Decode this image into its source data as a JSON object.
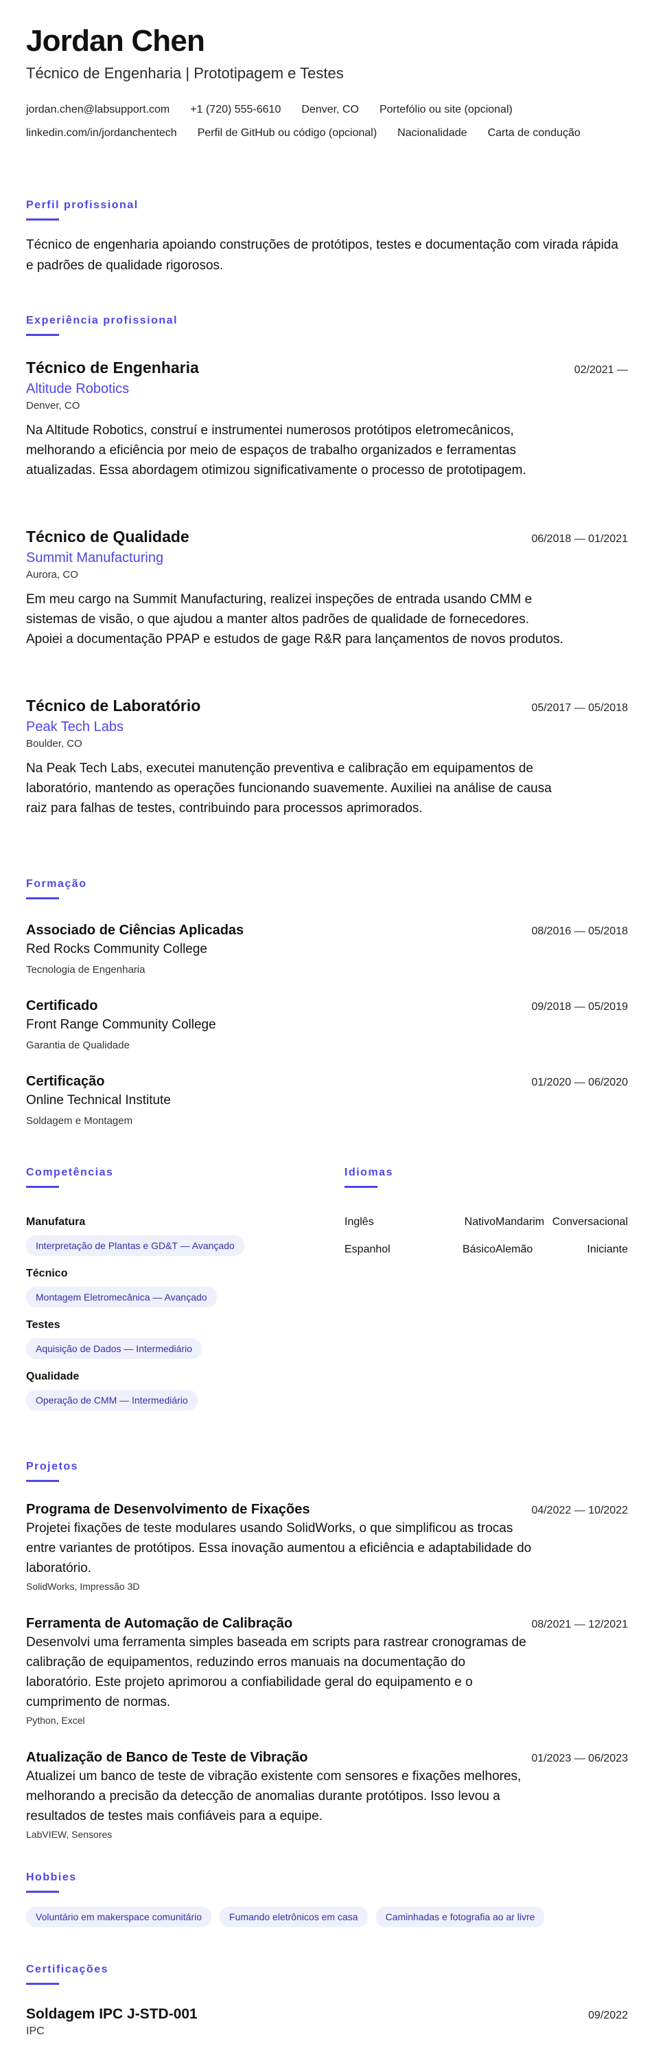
{
  "header": {
    "name": "Jordan Chen",
    "headline": "Técnico de Engenharia | Prototipagem e Testes",
    "contact": [
      "jordan.chen@labsupport.com",
      "+1 (720) 555-6610",
      "Denver, CO",
      "Portefólio ou site (opcional)",
      "linkedin.com/in/jordanchentech",
      "Perfil de GitHub ou código (opcional)",
      "Nacionalidade",
      "Carta de condução"
    ]
  },
  "sections": {
    "profile": "Perfil profissional",
    "experience": "Experiência profissional",
    "education": "Formação",
    "skills": "Competências",
    "languages": "Idiomas",
    "projects": "Projetos",
    "hobbies": "Hobbies",
    "certifications": "Certificações"
  },
  "summary": "Técnico de engenharia apoiando construções de protótipos, testes e documentação com virada rápida e padrões de qualidade rigorosos.",
  "experience": [
    {
      "title": "Técnico de Engenharia",
      "dates": "02/2021 —",
      "company": "Altitude Robotics",
      "location": "Denver, CO",
      "description": "Na Altitude Robotics, construí e instrumentei numerosos protótipos eletromecânicos, melhorando a eficiência por meio de espaços de trabalho organizados e ferramentas atualizadas. Essa abordagem otimizou significativamente o processo de prototipagem."
    },
    {
      "title": "Técnico de Qualidade",
      "dates": "06/2018 — 01/2021",
      "company": "Summit Manufacturing",
      "location": "Aurora, CO",
      "description": "Em meu cargo na Summit Manufacturing, realizei inspeções de entrada usando CMM e sistemas de visão, o que ajudou a manter altos padrões de qualidade de fornecedores. Apoiei a documentação PPAP e estudos de gage R&R para lançamentos de novos produtos."
    },
    {
      "title": "Técnico de Laboratório",
      "dates": "05/2017 — 05/2018",
      "company": "Peak Tech Labs",
      "location": "Boulder, CO",
      "description": "Na Peak Tech Labs, executei manutenção preventiva e calibração em equipamentos de laboratório, mantendo as operações funcionando suavemente. Auxiliei na análise de causa raiz para falhas de testes, contribuindo para processos aprimorados."
    }
  ],
  "education": [
    {
      "degree": "Associado de Ciências Aplicadas",
      "dates": "08/2016 — 05/2018",
      "school": "Red Rocks Community College",
      "field": "Tecnologia de Engenharia"
    },
    {
      "degree": "Certificado",
      "dates": "09/2018 — 05/2019",
      "school": "Front Range Community College",
      "field": "Garantia de Qualidade"
    },
    {
      "degree": "Certificação",
      "dates": "01/2020 — 06/2020",
      "school": "Online Technical Institute",
      "field": "Soldagem e Montagem"
    }
  ],
  "skills": [
    {
      "name": "Manufatura",
      "item": "Interpretação de Plantas e GD&T — Avançado"
    },
    {
      "name": "Técnico",
      "item": "Montagem Eletromecânica — Avançado"
    },
    {
      "name": "Testes",
      "item": "Aquisição de Dados — Intermediário"
    },
    {
      "name": "Qualidade",
      "item": "Operação de CMM — Intermediário"
    }
  ],
  "languages": [
    {
      "name": "Inglês",
      "level": "Nativo"
    },
    {
      "name": "Mandarim",
      "level": "Conversacional"
    },
    {
      "name": "Espanhol",
      "level": "Básico"
    },
    {
      "name": "Alemão",
      "level": "Iniciante"
    }
  ],
  "projects": [
    {
      "title": "Programa de Desenvolvimento de Fixações",
      "dates": "04/2022 — 10/2022",
      "description": "Projetei fixações de teste modulares usando SolidWorks, o que simplificou as trocas entre variantes de protótipos. Essa inovação aumentou a eficiência e adaptabilidade do laboratório.",
      "tech": "SolidWorks, Impressão 3D"
    },
    {
      "title": "Ferramenta de Automação de Calibração",
      "dates": "08/2021 — 12/2021",
      "description": "Desenvolvi uma ferramenta simples baseada em scripts para rastrear cronogramas de calibração de equipamentos, reduzindo erros manuais na documentação do laboratório. Este projeto aprimorou a confiabilidade geral do equipamento e o cumprimento de normas.",
      "tech": "Python, Excel"
    },
    {
      "title": "Atualização de Banco de Teste de Vibração",
      "dates": "01/2023 — 06/2023",
      "description": "Atualizei um banco de teste de vibração existente com sensores e fixações melhores, melhorando a precisão da detecção de anomalias durante protótipos. Isso levou a resultados de testes mais confiáveis para a equipe.",
      "tech": "LabVIEW, Sensores"
    }
  ],
  "hobbies": [
    "Voluntário em makerspace comunitário",
    "Fumando eletrônicos em casa",
    "Caminhadas e fotografia ao ar livre"
  ],
  "certifications": [
    {
      "name": "Soldagem IPC J-STD-001",
      "issuer": "IPC",
      "date": "09/2022"
    }
  ]
}
